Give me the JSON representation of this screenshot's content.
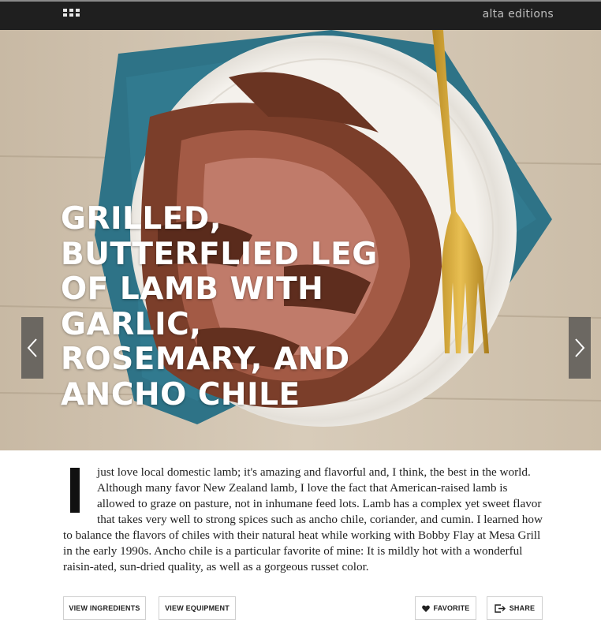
{
  "header": {
    "menu_icon": "grid-icon",
    "brand": "alta editions"
  },
  "hero": {
    "title": "GRILLED, BUTTERFLIED LEG OF LAMB WITH GARLIC, ROSEMARY, AND ANCHO CHILE",
    "prev_icon": "chevron-left-icon",
    "next_icon": "chevron-right-icon"
  },
  "article": {
    "dropcap": "I",
    "body": "just love local domestic lamb; it's amazing and flavorful and, I think, the best in the world. Although many favor New Zealand lamb, I love the fact that American-raised lamb is allowed to graze on pasture, not in inhumane feed lots. Lamb has a complex yet sweet flavor that takes very well to strong spices such as ancho chile, coriander, and cumin. I learned how to balance the flavors of chiles with their natural heat while working with Bobby Flay at Mesa Grill in the early 1990s. Ancho chile is a particular favorite of mine: It is mildly hot with a wonderful raisin-ated, sun-dried quality, as well as a gorgeous russet color."
  },
  "actions": {
    "view_ingredients": "VIEW INGREDIENTS",
    "view_equipment": "VIEW EQUIPMENT",
    "favorite": "FAVORITE",
    "share": "SHARE",
    "favorite_icon": "heart-icon",
    "share_icon": "share-icon"
  }
}
